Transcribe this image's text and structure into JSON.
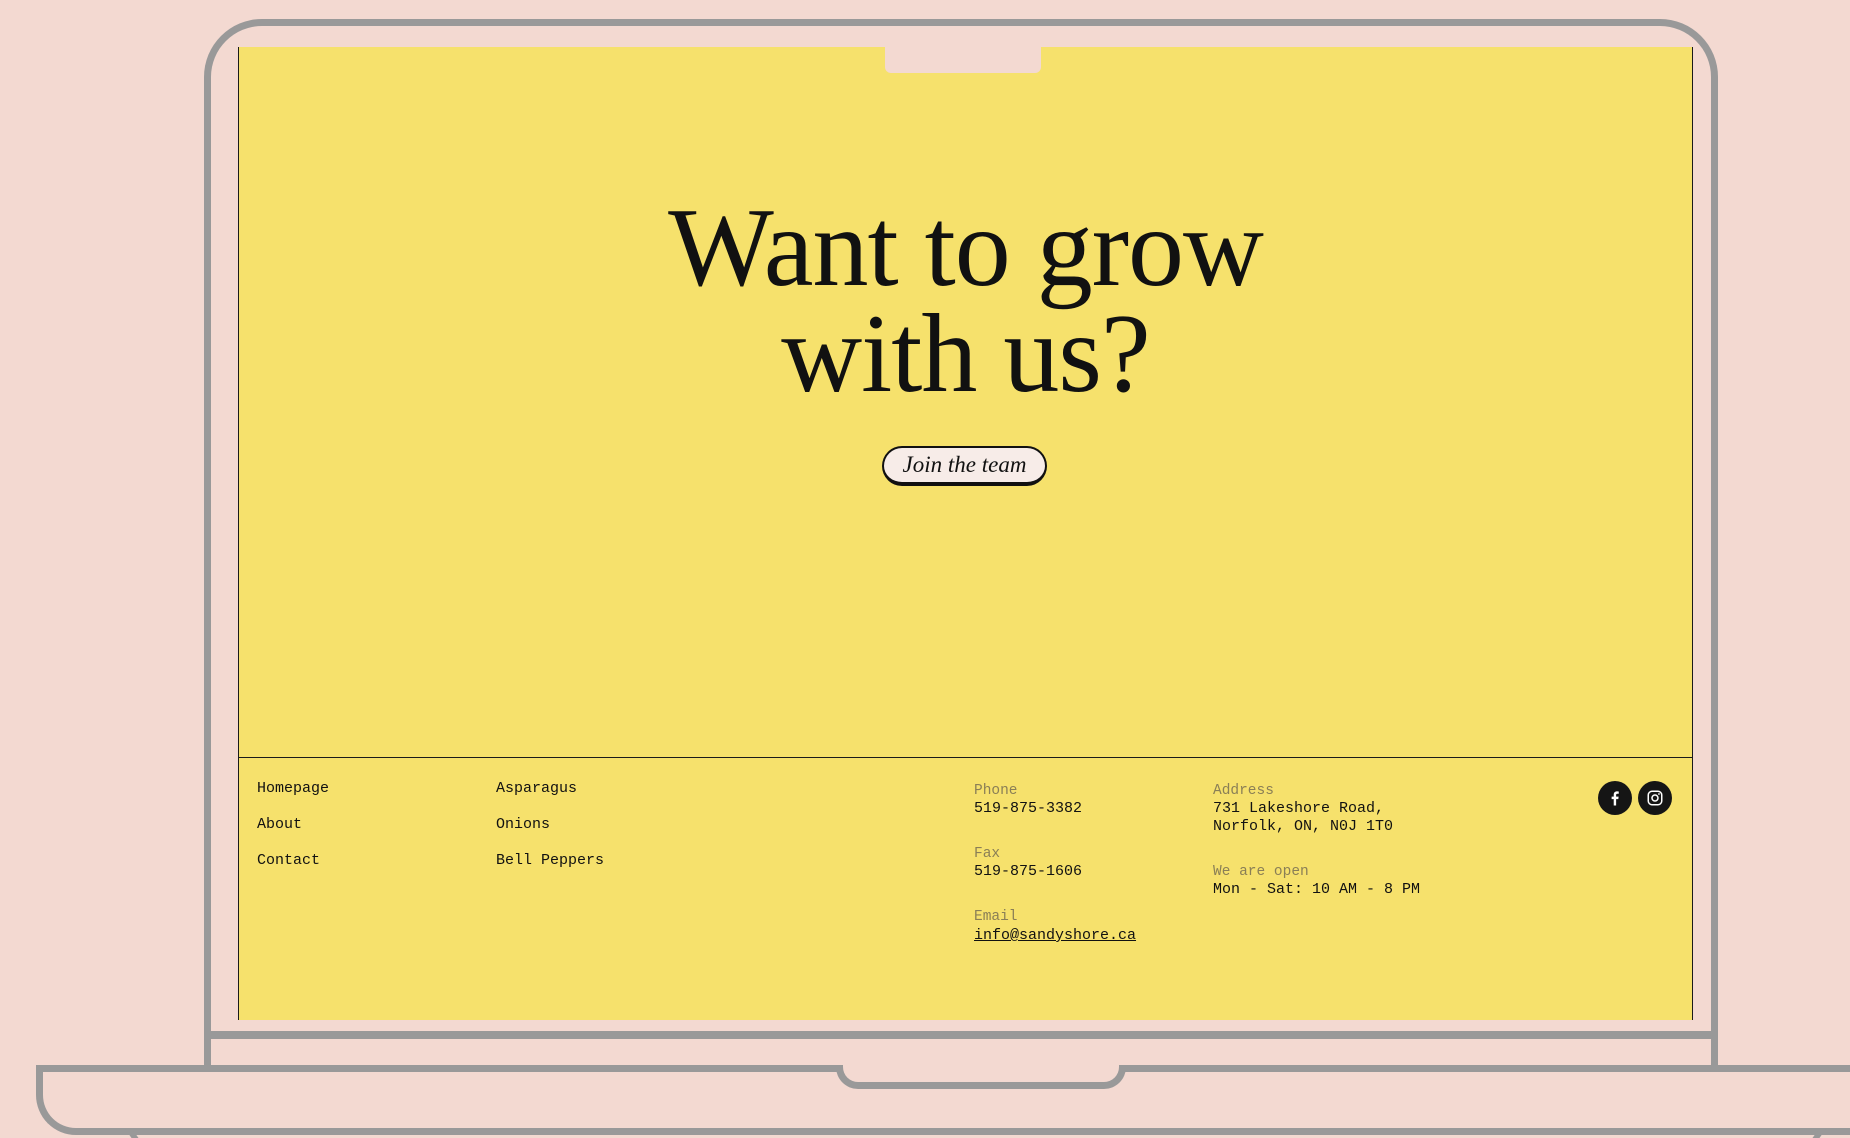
{
  "hero": {
    "title_line1": "Want to grow",
    "title_line2": "with us?",
    "cta_label": "Join the team"
  },
  "footer": {
    "nav_primary": [
      "Homepage",
      "About",
      "Contact"
    ],
    "nav_products": [
      "Asparagus",
      "Onions",
      "Bell Peppers"
    ],
    "phone": {
      "label": "Phone",
      "value": "519-875-3382"
    },
    "fax": {
      "label": "Fax",
      "value": "519-875-1606"
    },
    "email": {
      "label": "Email",
      "value": "info@sandyshore.ca"
    },
    "address": {
      "label": "Address",
      "line1": "731 Lakeshore Road,",
      "line2": "Norfolk, ON, N0J 1T0"
    },
    "hours": {
      "label": "We are open",
      "value": "Mon - Sat: 10 AM - 8 PM"
    },
    "social": [
      "facebook-icon",
      "instagram-icon"
    ]
  },
  "colors": {
    "page_background": "#f3d9d1",
    "screen_background": "#f6e16c",
    "frame": "#999999",
    "text": "#111111",
    "button": "#f7ece8"
  }
}
